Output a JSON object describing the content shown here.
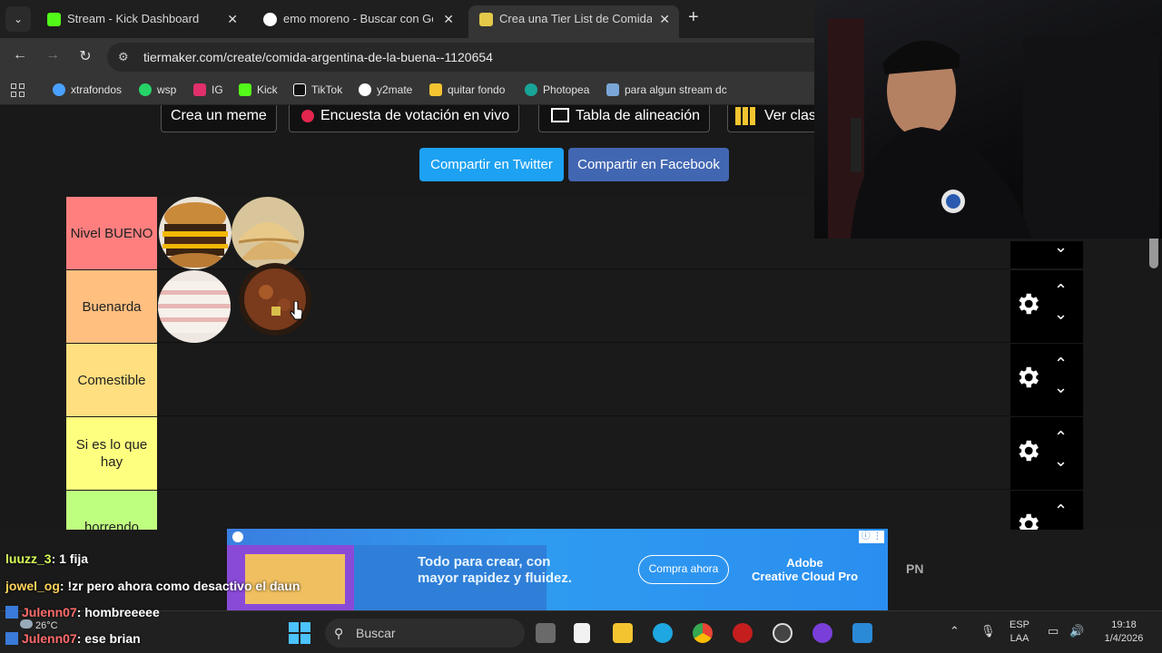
{
  "tabs": [
    {
      "title": "Stream - Kick Dashboard",
      "favicon": "kick-icon",
      "color": "#53fc18",
      "active": false
    },
    {
      "title": "emo moreno - Buscar con Google",
      "favicon": "google-icon",
      "color": "#ffffff",
      "active": false
    },
    {
      "title": "Crea una Tier List de Comida Argentina",
      "favicon": "tiermaker-icon",
      "color": "#e3c94a",
      "active": true
    }
  ],
  "toolbar": {
    "url": "tiermaker.com/create/comida-argentina-de-la-buena--1120654"
  },
  "bookmarks": [
    {
      "label": "xtrafondos",
      "color": "#4aa0ff"
    },
    {
      "label": "wsp",
      "color": "#25d366"
    },
    {
      "label": "IG",
      "color": "#e1306c"
    },
    {
      "label": "Kick",
      "color": "#53fc18"
    },
    {
      "label": "TikTok",
      "color": "#ffffff"
    },
    {
      "label": "y2mate",
      "color": "#ff4d4d"
    },
    {
      "label": "quitar fondo",
      "color": "#f4c430"
    },
    {
      "label": "Photopea",
      "color": "#18a497"
    },
    {
      "label": "para algun stream dc",
      "color": "#7aa7d8"
    }
  ],
  "page": {
    "top_buttons": [
      "Crea un meme",
      "Encuesta de votación en vivo",
      "Tabla de alineación",
      "Ver clas"
    ],
    "share_twitter": "Compartir en Twitter",
    "share_facebook": "Compartir en Facebook",
    "twitter_color": "#1da1f2",
    "facebook_color": "#4267b2"
  },
  "tiers": [
    {
      "label": "Nivel BUENO",
      "color": "#ff7f7f"
    },
    {
      "label": "Buenarda",
      "color": "#ffbf7f"
    },
    {
      "label": "Comestible",
      "color": "#ffdf7f"
    },
    {
      "label": "Si es lo que hay",
      "color": "#ffff7f"
    },
    {
      "label": "horrendo",
      "color": "#bfff7f"
    }
  ],
  "ad": {
    "headline_1": "Todo para crear, con",
    "headline_2": "mayor rapidez y fluidez.",
    "cta": "Compra ahora",
    "brand_1": "Adobe",
    "brand_2": "Creative Cloud Pro",
    "side_text": "PN"
  },
  "chat": [
    {
      "user": "luuzz_3",
      "msg": ": 1 fija",
      "color": "#d7ff5a",
      "badge": false
    },
    {
      "user": "jowel_og",
      "msg": ": !zr pero ahora como desactivo el daun",
      "color": "#ffd35a",
      "badge": false
    },
    {
      "user": "Julenn07",
      "msg": ": hombreeeee",
      "color": "#ff6b6b",
      "badge": true
    },
    {
      "user": "Julenn07",
      "msg": ": ese brian",
      "color": "#ff6b6b",
      "badge": true
    }
  ],
  "taskbar": {
    "search_placeholder": "Buscar",
    "weather": "26°C",
    "lang_1": "ESP",
    "lang_2": "LAA",
    "time": "19:18",
    "date": "1/4/2026"
  }
}
